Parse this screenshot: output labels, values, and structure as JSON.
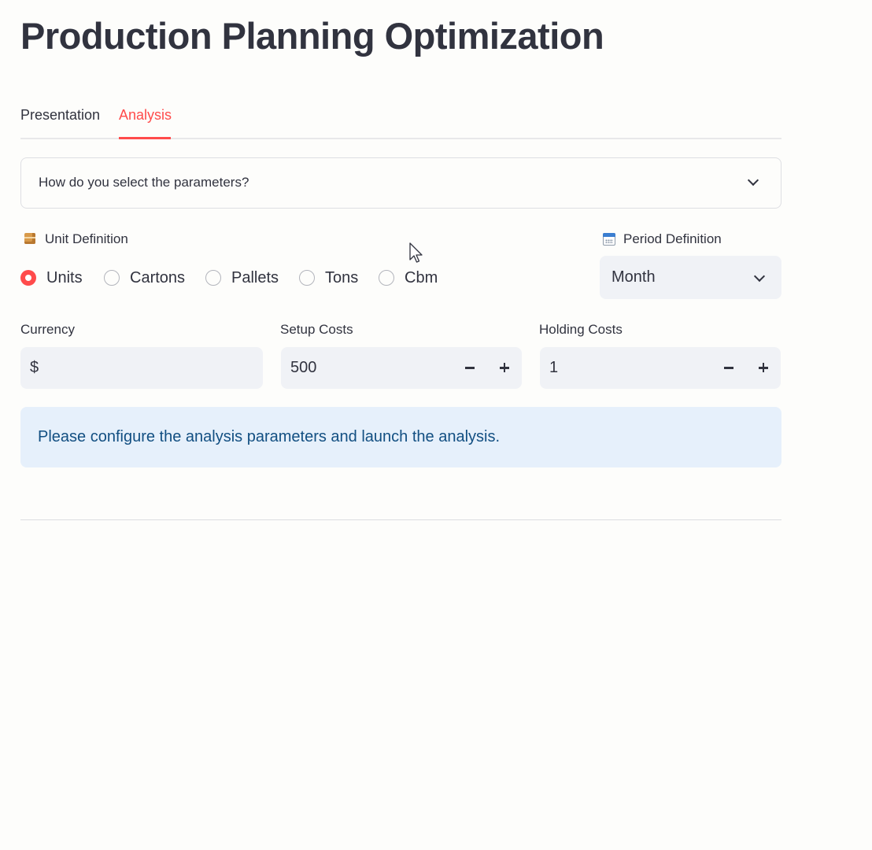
{
  "page": {
    "title": "Production Planning Optimization"
  },
  "tabs": [
    {
      "label": "Presentation",
      "active": false
    },
    {
      "label": "Analysis",
      "active": true
    }
  ],
  "expander": {
    "label": "How do you select the parameters?",
    "icon": "chevron-down-icon"
  },
  "unit_definition": {
    "label": "Unit Definition",
    "icon": "package-icon",
    "options": [
      "Units",
      "Cartons",
      "Pallets",
      "Tons",
      "Cbm"
    ],
    "selected": "Units"
  },
  "period_definition": {
    "label": "Period Definition",
    "icon": "calendar-icon",
    "value": "Month"
  },
  "currency": {
    "label": "Currency",
    "value": "$"
  },
  "setup_costs": {
    "label": "Setup Costs",
    "value": "500"
  },
  "holding_costs": {
    "label": "Holding Costs",
    "value": "1"
  },
  "info_alert": {
    "text": "Please configure the analysis parameters and launch the analysis."
  },
  "colors": {
    "accent": "#ff4b4b",
    "text": "#31333f",
    "input_bg": "#f0f2f6",
    "info_bg": "#e6f0fb",
    "info_text": "#124f82",
    "page_bg": "#fdfdfb"
  }
}
